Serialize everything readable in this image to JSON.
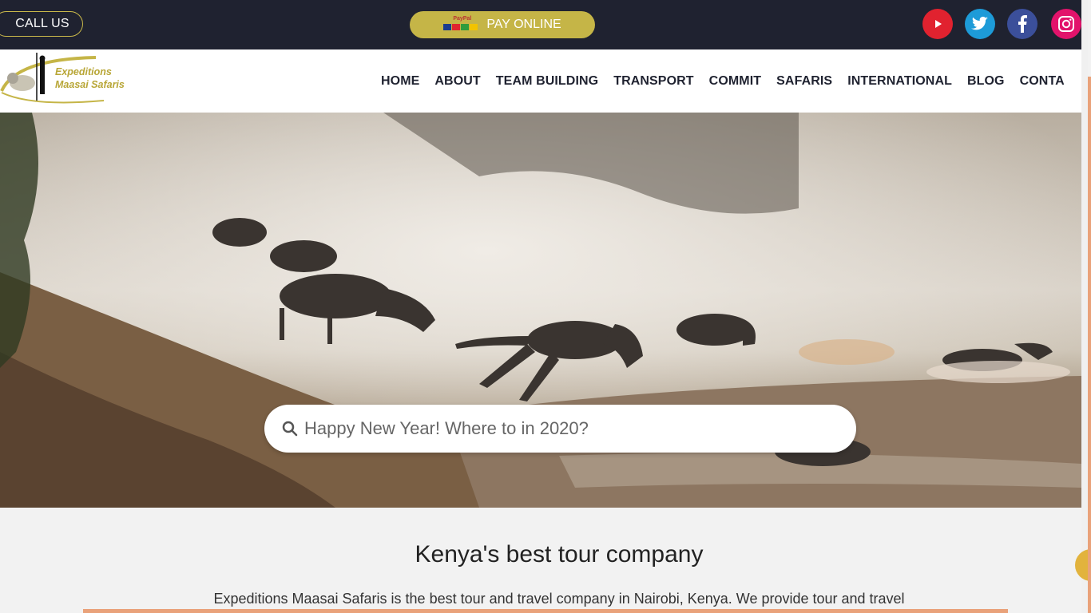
{
  "topbar": {
    "call_label": "CALL US",
    "pay_label": "PAY ONLINE",
    "paypal_text": "PayPal",
    "colors": {
      "background": "#1f2230",
      "accent": "#c5b547"
    },
    "social": [
      "youtube-icon",
      "twitter-icon",
      "facebook-icon",
      "instagram-icon"
    ]
  },
  "navbar": {
    "logo_line1": "Expeditions",
    "logo_line2": "Maasai Safaris",
    "items": [
      "HOME",
      "ABOUT",
      "TEAM BUILDING",
      "TRANSPORT",
      "COMMIT",
      "SAFARIS",
      "INTERNATIONAL",
      "BLOG",
      "CONTA"
    ]
  },
  "hero": {
    "search_placeholder": "Happy New Year! Where to in 2020?"
  },
  "content": {
    "title": "Kenya's best tour company",
    "intro": "Expeditions Maasai Safaris is the best tour and travel company in Nairobi, Kenya. We provide tour and travel"
  }
}
